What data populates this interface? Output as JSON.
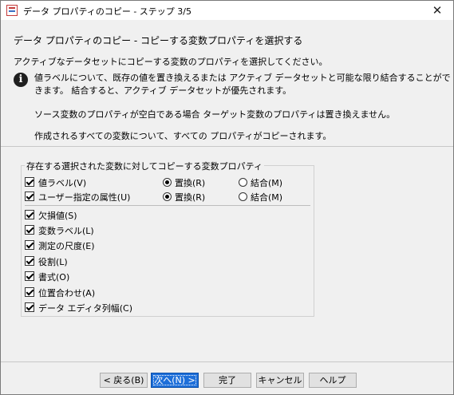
{
  "window": {
    "title": "データ プロパティのコピー - ステップ 3/5",
    "close_glyph": "✕"
  },
  "header": {
    "heading": "データ プロパティのコピー - コピーする変数プロパティを選択する",
    "subheading": "アクティブなデータセットにコピーする変数のプロパティを選択してください。",
    "info_line1": "値ラベルについて、既存の値を置き換えるまたは アクティブ データセットと可能な限り結合することがで",
    "info_line2": "きます。 結合すると、アクティブ データセットが優先されます。",
    "note1": "ソース変数のプロパティが空白である場合 ターゲット変数のプロパティは置き換えません。",
    "note2": "作成されるすべての変数について、すべての プロパティがコピーされます。"
  },
  "group": {
    "title": "存在する選択された変数に対してコピーする変数プロパティ",
    "value_labels": {
      "label": "値ラベル(V)",
      "checked": true,
      "replace": "置換(R)",
      "merge": "結合(M)",
      "selected": "replace"
    },
    "custom_attrs": {
      "label": "ユーザー指定の属性(U)",
      "checked": true,
      "replace": "置換(R)",
      "merge": "結合(M)",
      "selected": "replace"
    },
    "items": [
      {
        "label": "欠損値(S)",
        "checked": true
      },
      {
        "label": "変数ラベル(L)",
        "checked": true
      },
      {
        "label": "測定の尺度(E)",
        "checked": true
      },
      {
        "label": "役割(L)",
        "checked": true
      },
      {
        "label": "書式(O)",
        "checked": true
      },
      {
        "label": "位置合わせ(A)",
        "checked": true
      },
      {
        "label": "データ エディタ列幅(C)",
        "checked": true
      }
    ]
  },
  "buttons": {
    "back": "< 戻る(B)",
    "next": "次へ(N) >",
    "finish": "完了",
    "cancel": "キャンセル",
    "help": "ヘルプ"
  },
  "icons": {
    "app": "app-window-icon",
    "info": "info-icon",
    "close": "close-icon"
  }
}
